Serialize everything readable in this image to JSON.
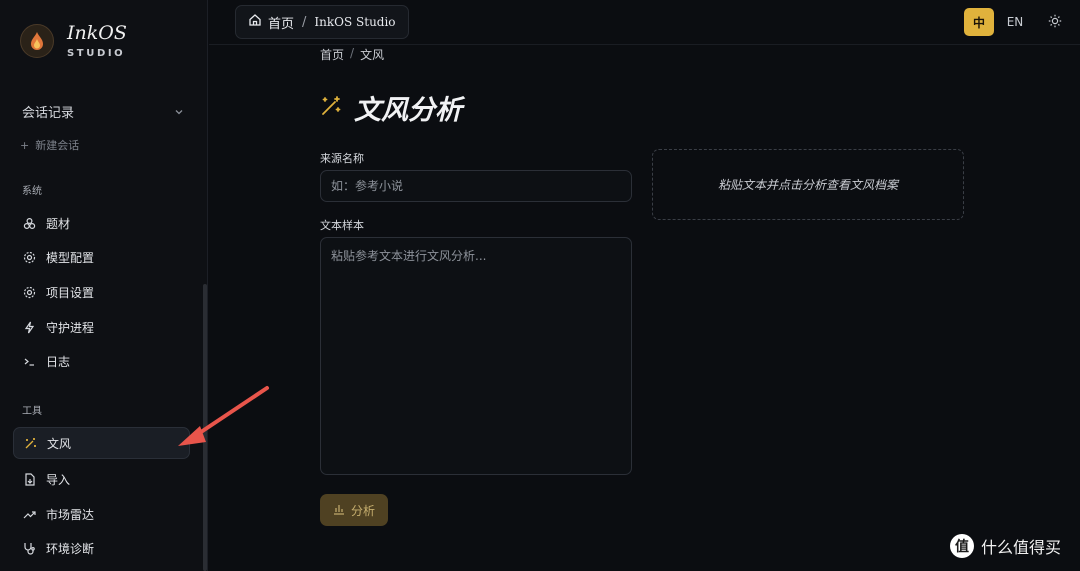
{
  "brand": {
    "name": "InkOS",
    "subtitle": "STUDIO"
  },
  "sessions": {
    "title": "会话记录",
    "new_chat": "新建会话"
  },
  "sidebar": {
    "system_label": "系统",
    "system_items": [
      {
        "label": "题材",
        "icon": "material-icon"
      },
      {
        "label": "模型配置",
        "icon": "gear-icon"
      },
      {
        "label": "项目设置",
        "icon": "gear-icon"
      },
      {
        "label": "守护进程",
        "icon": "lightning-icon"
      },
      {
        "label": "日志",
        "icon": "terminal-icon"
      }
    ],
    "tools_label": "工具",
    "tool_items": [
      {
        "label": "文风",
        "icon": "magic-wand-icon",
        "active": true
      },
      {
        "label": "导入",
        "icon": "import-file-icon"
      },
      {
        "label": "市场雷达",
        "icon": "trend-icon"
      },
      {
        "label": "环境诊断",
        "icon": "stethoscope-icon"
      }
    ]
  },
  "topbar": {
    "home_label": "首页",
    "separator": "/",
    "studio_label": "InkOS Studio",
    "lang_zh": "中",
    "lang_en": "EN",
    "active_lang": "zh"
  },
  "page": {
    "breadcrumb_home": "首页",
    "breadcrumb_sep": "/",
    "breadcrumb_current": "文风",
    "title": "文风分析",
    "source_label": "来源名称",
    "source_placeholder": "如：参考小说",
    "sample_label": "文本样本",
    "sample_placeholder": "粘贴参考文本进行文风分析...",
    "analyze_button": "分析",
    "result_hint": "粘贴文本并点击分析查看文风档案"
  },
  "watermark": {
    "logo_char": "值",
    "text": "什么值得买"
  },
  "colors": {
    "accent": "#e0b23c",
    "arrow": "#e8554b"
  }
}
